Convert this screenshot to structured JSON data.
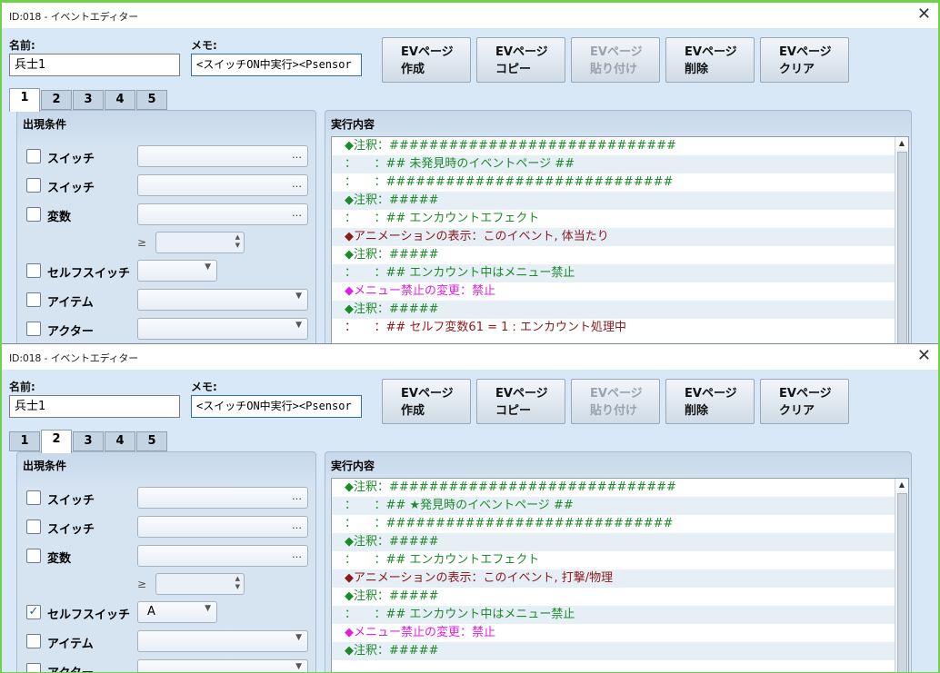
{
  "windows": [
    {
      "title": "ID:018 - イベントエディター",
      "name_label": "名前:",
      "name_value": "兵士1",
      "memo_label": "メモ:",
      "memo_value": "<スイッチON中実行><Psensor",
      "buttons": [
        {
          "line1": "EVページ",
          "line2": "作成",
          "disabled": false
        },
        {
          "line1": "EVページ",
          "line2": "コピー",
          "disabled": false
        },
        {
          "line1": "EVページ",
          "line2": "貼り付け",
          "disabled": true
        },
        {
          "line1": "EVページ",
          "line2": "削除",
          "disabled": false
        },
        {
          "line1": "EVページ",
          "line2": "クリア",
          "disabled": false
        }
      ],
      "tabs": [
        "1",
        "2",
        "3",
        "4",
        "5"
      ],
      "active_tab": "1",
      "conditions_title": "出現条件",
      "conditions": {
        "switch1": "スイッチ",
        "switch2": "スイッチ",
        "variable": "変数",
        "geq": "≥",
        "self_switch": "セルフスイッチ",
        "self_switch_checked": false,
        "self_switch_value": "",
        "item": "アイテム",
        "actor": "アクター",
        "ellipsis": "…"
      },
      "exec_title": "実行内容",
      "commands": [
        {
          "text": "◆注釈：#############################",
          "color": "green"
        },
        {
          "text": "：　　：## 未発見時のイベントページ ##",
          "color": "green"
        },
        {
          "text": "：　　：#############################",
          "color": "green"
        },
        {
          "text": "◆注釈：#####",
          "color": "green"
        },
        {
          "text": "：　　：## エンカウントエフェクト",
          "color": "green"
        },
        {
          "text": "◆アニメーションの表示：このイベント, 体当たり",
          "color": "red"
        },
        {
          "text": "◆注釈：#####",
          "color": "green"
        },
        {
          "text": "：　　：## エンカウント中はメニュー禁止",
          "color": "green"
        },
        {
          "text": "◆メニュー禁止の変更：禁止",
          "color": "magenta"
        },
        {
          "text": "◆注釈：#####",
          "color": "green"
        },
        {
          "text": "：　　：## セルフ変数61 = 1 : エンカウント処理中",
          "color": "red"
        }
      ]
    },
    {
      "title": "ID:018 - イベントエディター",
      "name_label": "名前:",
      "name_value": "兵士1",
      "memo_label": "メモ:",
      "memo_value": "<スイッチON中実行><Psensor",
      "buttons": [
        {
          "line1": "EVページ",
          "line2": "作成",
          "disabled": false
        },
        {
          "line1": "EVページ",
          "line2": "コピー",
          "disabled": false
        },
        {
          "line1": "EVページ",
          "line2": "貼り付け",
          "disabled": true
        },
        {
          "line1": "EVページ",
          "line2": "削除",
          "disabled": false
        },
        {
          "line1": "EVページ",
          "line2": "クリア",
          "disabled": false
        }
      ],
      "tabs": [
        "1",
        "2",
        "3",
        "4",
        "5"
      ],
      "active_tab": "2",
      "conditions_title": "出現条件",
      "conditions": {
        "switch1": "スイッチ",
        "switch2": "スイッチ",
        "variable": "変数",
        "geq": "≥",
        "self_switch": "セルフスイッチ",
        "self_switch_checked": true,
        "self_switch_value": "A",
        "item": "アイテム",
        "actor": "アクター",
        "ellipsis": "…"
      },
      "exec_title": "実行内容",
      "commands": [
        {
          "text": "◆注釈：#############################",
          "color": "green"
        },
        {
          "text": "：　　：## ★発見時のイベントページ ##",
          "color": "green"
        },
        {
          "text": "：　　：#############################",
          "color": "green"
        },
        {
          "text": "◆注釈：#####",
          "color": "green"
        },
        {
          "text": "：　　：## エンカウントエフェクト",
          "color": "green"
        },
        {
          "text": "◆アニメーションの表示：このイベント, 打撃/物理",
          "color": "red"
        },
        {
          "text": "◆注釈：#####",
          "color": "green"
        },
        {
          "text": "：　　：## エンカウント中はメニュー禁止",
          "color": "green"
        },
        {
          "text": "◆メニュー禁止の変更：禁止",
          "color": "magenta"
        },
        {
          "text": "◆注釈：#####",
          "color": "green"
        }
      ]
    }
  ],
  "colors": {
    "comment_green": "#1d8a2a",
    "command_red": "#8b1a1a",
    "command_magenta": "#e020e0",
    "window_bg": "#d9e8f7",
    "desktop_border": "#6fd24a"
  }
}
